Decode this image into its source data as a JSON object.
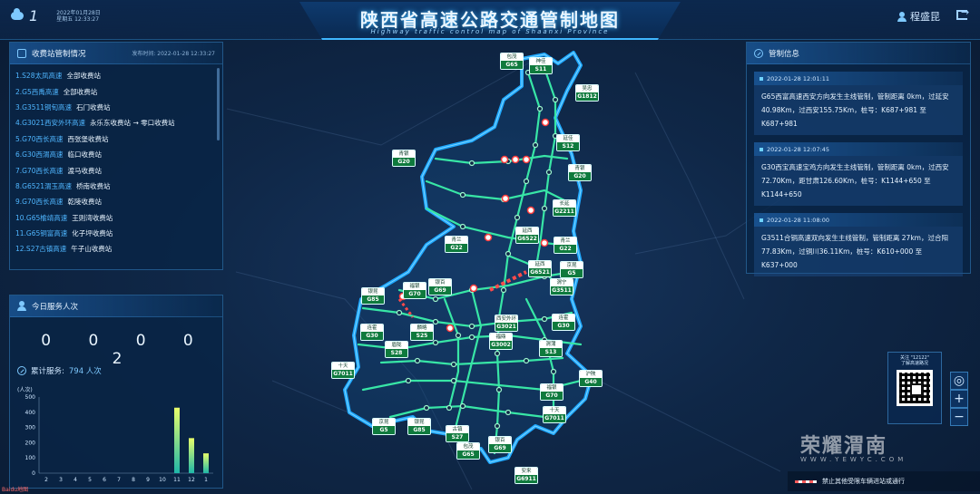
{
  "header": {
    "title": "陕西省高速公路交通管制地图",
    "subtitle": "Highway traffic control map of Shaanxi Province",
    "temperature": "1",
    "date": "2022年01月28日",
    "weekday_time": "星期五  12:33:27",
    "user_name": "程盛昆"
  },
  "toll_panel": {
    "title": "收费站管制情况",
    "publish_label": "发布时间:",
    "publish_time": "2022-01-28 12:33:27",
    "items": [
      {
        "road": "1.S28太凤高速",
        "status": "全部收费站"
      },
      {
        "road": "2.G5西禹高速",
        "status": "全部收费站"
      },
      {
        "road": "3.G3511铜旬高速",
        "status": "石门收费站"
      },
      {
        "road": "4.G3021西安外环高速",
        "status": "永乐东收费站 → 零口收费站"
      },
      {
        "road": "5.G70西长高速",
        "status": "西张堡收费站"
      },
      {
        "road": "6.G30西渭高速",
        "status": "临口收费站"
      },
      {
        "road": "7.G70西长高速",
        "status": "渡马收费站"
      },
      {
        "road": "8.G6521渭玉高速",
        "status": "桥南收费站"
      },
      {
        "road": "9.G70西长高速",
        "status": "乾陵收费站"
      },
      {
        "road": "10.G65榆靖高速",
        "status": "王则湾收费站"
      },
      {
        "road": "11.G65铜富高速",
        "status": "化子坪收费站"
      },
      {
        "road": "12.S27古镇高速",
        "status": "午子山收费站"
      }
    ]
  },
  "service_panel": {
    "title": "今日服务人次",
    "digits": "0 0 0 0 2",
    "total_label": "累计服务:",
    "total_value": "794 人次"
  },
  "control_panel": {
    "title": "管制信息",
    "items": [
      {
        "time": "2022-01-28 12:01:11",
        "text": "G65西富高速西安方向发生主线管制，管制距离 0km，过延安40.98Km，过西安155.75Km，桩号：K687+981 至 K687+981"
      },
      {
        "time": "2022-01-28 12:07:45",
        "text": "G30西宝高速宝鸡方向发生主线管制，管制距离 0km，过西安72.70Km，距甘肃126.60Km，桩号：K1144+650 至 K1144+650"
      },
      {
        "time": "2022-01-28 11:08:00",
        "text": "G3511合铜高速双向发生主线管制，管制距离 27km，过合阳77.83Km，过铜川36.11Km，桩号：K610+000 至 K637+000"
      }
    ]
  },
  "qr": {
    "line1": "关注 \"12122\"",
    "line2": "了解高速路况"
  },
  "brand": {
    "name": "荣耀渭南",
    "sub": "WWW.YEWYC.COM"
  },
  "legend": {
    "forbidden_text": "禁止其他受限车辆进站或通行"
  },
  "corner_logo": "Baidu地图",
  "chart_data": {
    "type": "bar",
    "ylabel": "(人次)",
    "categories": [
      "2",
      "3",
      "4",
      "5",
      "6",
      "7",
      "8",
      "9",
      "10",
      "11",
      "12",
      "1"
    ],
    "values": [
      0,
      0,
      0,
      0,
      0,
      0,
      0,
      0,
      0,
      430,
      230,
      130
    ],
    "ylim": [
      0,
      500
    ],
    "yticks": [
      0,
      100,
      200,
      300,
      400,
      500
    ],
    "grid": false
  },
  "road_tags": [
    {
      "name": "包茂",
      "code": "G65"
    },
    {
      "name": "神佳",
      "code": "S11"
    },
    {
      "name": "吴忠",
      "code": "G1812"
    },
    {
      "name": "延佳",
      "code": "S12"
    },
    {
      "name": "青银",
      "code": "G20"
    },
    {
      "name": "青银",
      "code": "G20"
    },
    {
      "name": "长延",
      "code": "G2211"
    },
    {
      "name": "延西",
      "code": "G6522"
    },
    {
      "name": "青兰",
      "code": "G22"
    },
    {
      "name": "青兰",
      "code": "G22"
    },
    {
      "name": "银昆",
      "code": "G85"
    },
    {
      "name": "福银",
      "code": "G70"
    },
    {
      "name": "银百",
      "code": "G69"
    },
    {
      "name": "延西",
      "code": "G6521"
    },
    {
      "name": "京昆",
      "code": "G5"
    },
    {
      "name": "渭宁",
      "code": "G3511"
    },
    {
      "name": "连霍",
      "code": "G30"
    },
    {
      "name": "麟略",
      "code": "S25"
    },
    {
      "name": "西安外环",
      "code": "G3021"
    },
    {
      "name": "连霍",
      "code": "G30"
    },
    {
      "name": "眉陇",
      "code": "S28"
    },
    {
      "name": "福鼎",
      "code": "G3002"
    },
    {
      "name": "渭蒲",
      "code": "S13"
    },
    {
      "name": "十天",
      "code": "G7011"
    },
    {
      "name": "沪陕",
      "code": "G40"
    },
    {
      "name": "福银",
      "code": "G70"
    },
    {
      "name": "十天",
      "code": "G7011"
    },
    {
      "name": "京昆",
      "code": "G5"
    },
    {
      "name": "银昆",
      "code": "G85"
    },
    {
      "name": "古镇",
      "code": "S27"
    },
    {
      "name": "包茂",
      "code": "G65"
    },
    {
      "name": "银百",
      "code": "G69"
    },
    {
      "name": "安来",
      "code": "G6911"
    }
  ]
}
